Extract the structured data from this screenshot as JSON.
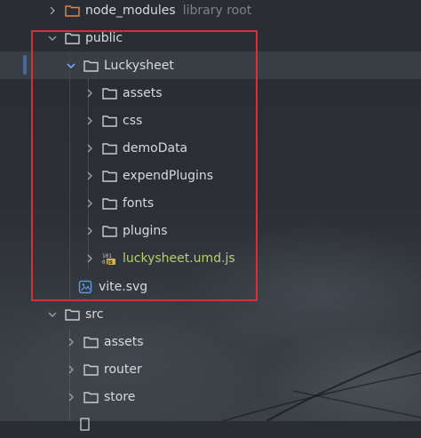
{
  "tree": {
    "rows": [
      {
        "label": "node_modules",
        "hint": "library root",
        "kind": "folder",
        "state": "collapsed"
      },
      {
        "label": "public",
        "kind": "folder",
        "state": "expanded"
      },
      {
        "label": "Luckysheet",
        "kind": "folder",
        "state": "expanded",
        "selected": true
      },
      {
        "label": "assets",
        "kind": "folder",
        "state": "collapsed"
      },
      {
        "label": "css",
        "kind": "folder",
        "state": "collapsed"
      },
      {
        "label": "demoData",
        "kind": "folder",
        "state": "collapsed"
      },
      {
        "label": "expendPlugins",
        "kind": "folder",
        "state": "collapsed"
      },
      {
        "label": "fonts",
        "kind": "folder",
        "state": "collapsed"
      },
      {
        "label": "plugins",
        "kind": "folder",
        "state": "collapsed"
      },
      {
        "label": "luckysheet.umd.js",
        "kind": "js-file",
        "state": "collapsed"
      },
      {
        "label": "vite.svg",
        "kind": "image-file"
      },
      {
        "label": "src",
        "kind": "folder",
        "state": "expanded"
      },
      {
        "label": "assets",
        "kind": "folder",
        "state": "collapsed"
      },
      {
        "label": "router",
        "kind": "folder",
        "state": "collapsed"
      },
      {
        "label": "store",
        "kind": "folder",
        "state": "collapsed"
      }
    ]
  },
  "icons": {
    "folder": "folder-icon",
    "excluded_folder": "excluded-folder-icon",
    "js_file": "binary-js-file-icon",
    "image_file": "image-file-icon",
    "collapsed": "chevron-right-icon",
    "expanded": "chevron-down-icon"
  },
  "colors": {
    "text": "#d7dade",
    "hint": "#7d828a",
    "js_file_text": "#b2d16c",
    "excluded_folder": "#d98a4c",
    "expanded_chevron": "#6fa8f5",
    "focus_strip": "#4e8ef2",
    "highlight_box": "#d0323a"
  }
}
